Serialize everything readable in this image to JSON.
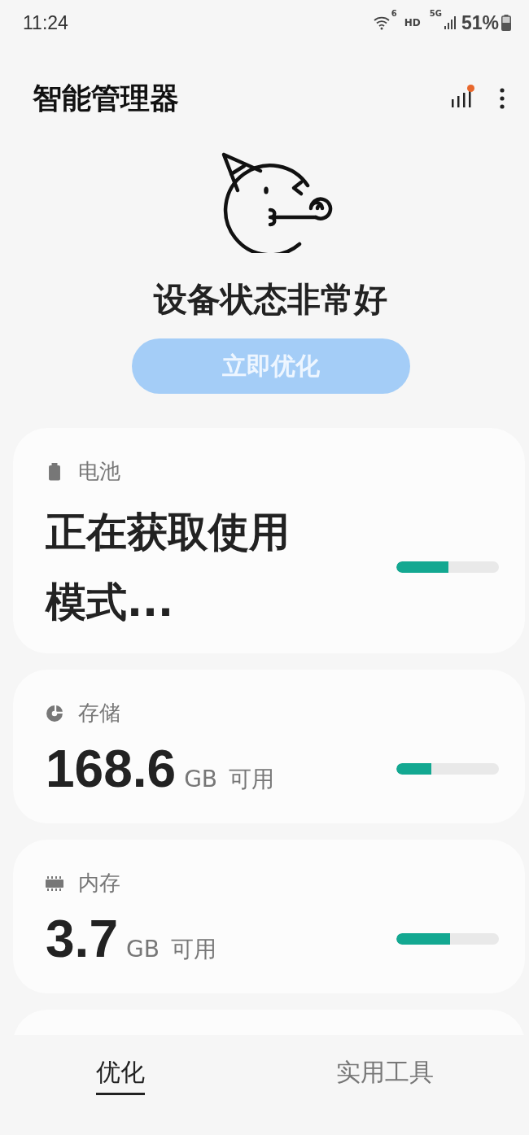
{
  "status_bar": {
    "time": "11:24",
    "wifi_badge": "6",
    "hd": "HD",
    "network": "5G",
    "battery": "51%"
  },
  "app_bar": {
    "title": "智能管理器",
    "notification_dot": true
  },
  "hero": {
    "status": "设备状态非常好",
    "button": {
      "label": "立即优化",
      "disabled": true
    }
  },
  "cards": [
    {
      "kind": "battery",
      "label": "电池",
      "value": "正在获取使用模式...",
      "level": 0.51
    },
    {
      "kind": "storage",
      "label": "存储",
      "value": "168.6",
      "unit": "GB",
      "suffix": "可用",
      "level": 0.34
    },
    {
      "kind": "memory",
      "label": "内存",
      "value": "3.7",
      "unit": "GB",
      "suffix": "可用",
      "level": 0.52
    },
    {
      "kind": "partial"
    }
  ],
  "bottom_tabs": [
    {
      "label": "优化",
      "selected": true
    },
    {
      "label": "实用工具",
      "selected": false
    }
  ]
}
